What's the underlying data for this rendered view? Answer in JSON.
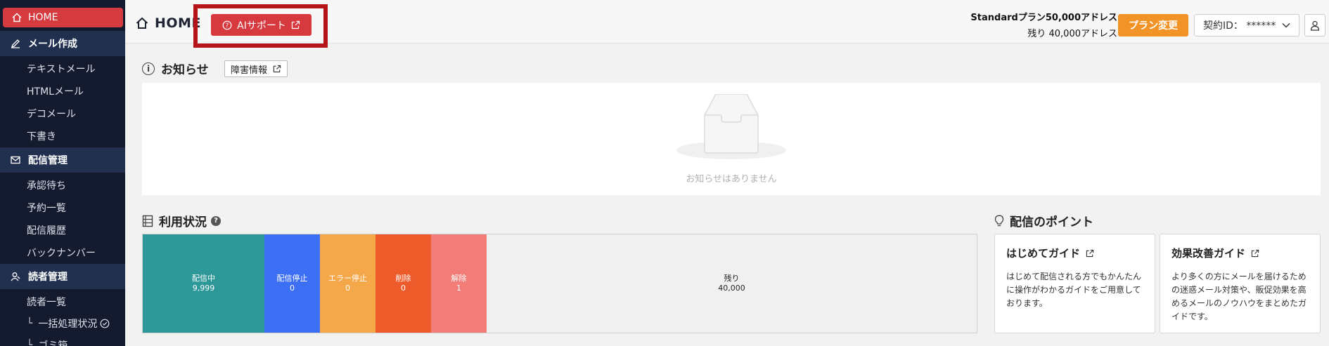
{
  "sidebar": {
    "home": "HOME",
    "sections": [
      {
        "label": "メール作成",
        "items": [
          "テキストメール",
          "HTMLメール",
          "デコメール",
          "下書き"
        ]
      },
      {
        "label": "配信管理",
        "items": [
          "承認待ち",
          "予約一覧",
          "配信履歴",
          "バックナンバー"
        ]
      },
      {
        "label": "読者管理",
        "items": [
          "読者一覧"
        ],
        "subitems": [
          "一括処理状況",
          "ゴミ箱"
        ]
      }
    ],
    "tree_marker": "└"
  },
  "header": {
    "title": "HOME",
    "ai_support": "AIサポート",
    "plan_name": "Standardプラン50,000アドレス",
    "plan_remaining": "残り 40,000アドレス",
    "plan_change": "プラン変更",
    "contract_label": "契約ID：",
    "contract_value": "******"
  },
  "notice": {
    "title": "お知らせ",
    "trouble_info": "障害情報",
    "empty_message": "お知らせはありません"
  },
  "usage": {
    "title": "利用状況",
    "help": "?",
    "total": 50000,
    "segments": [
      {
        "label": "配信中",
        "value": "9,999",
        "color": "#2e9797"
      },
      {
        "label": "配信停止",
        "value": "0",
        "color": "#3d6ff5"
      },
      {
        "label": "エラー停止",
        "value": "0",
        "color": "#f5a84a"
      },
      {
        "label": "削除",
        "value": "0",
        "color": "#ee5b2b"
      },
      {
        "label": "解除",
        "value": "1",
        "color": "#f27c78"
      },
      {
        "label": "残り",
        "value": "40,000",
        "color": "#f0f0f0"
      }
    ]
  },
  "points": {
    "title": "配信のポイント",
    "cards": [
      {
        "title": "はじめてガイド",
        "body": "はじめて配信される方でもかんたんに操作がわかるガイドをご用意しております。"
      },
      {
        "title": "効果改善ガイド",
        "body": "より多くの方にメールを届けるための迷惑メール対策や、販促効果を高めるメールのノウハウをまとめたガイドです。"
      }
    ]
  }
}
